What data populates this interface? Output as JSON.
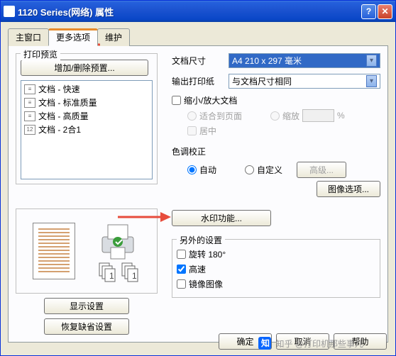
{
  "window": {
    "title": "1120 Series(网络) 属性"
  },
  "titlebar_buttons": {
    "help": "?",
    "close": "✕"
  },
  "tabs": [
    "主窗口",
    "更多选项",
    "维护"
  ],
  "active_tab": 1,
  "preview": {
    "group_label": "打印预览",
    "add_button": "增加/删除预置...",
    "items": [
      {
        "label": "文档 - 快速"
      },
      {
        "label": "文档 - 标准质量"
      },
      {
        "label": "文档 - 高质量"
      },
      {
        "label": "文档 - 2合1"
      }
    ],
    "show_settings": "显示设置",
    "restore_defaults": "恢复缺省设置"
  },
  "right": {
    "paper_size_label": "文档尺寸",
    "paper_size_value": "A4 210 x 297 毫米",
    "output_paper_label": "输出打印纸",
    "output_paper_value": "与文档尺寸相同",
    "zoom_check": "缩小/放大文档",
    "fit_page": "适合到页面",
    "zoom": "缩放",
    "percent": "%",
    "center": "居中",
    "color_label": "色调校正",
    "auto": "自动",
    "custom": "自定义",
    "advanced": "高级...",
    "image_options": "图像选项...",
    "watermark_btn": "水印功能...",
    "extra_label": "另外的设置",
    "rotate": "旋转 180°",
    "highspeed": "高速",
    "mirror": "镜像图像"
  },
  "footer": {
    "ok": "确定",
    "cancel": "取消",
    "help": "帮助"
  },
  "branding": "知乎 @打印机那些事儿"
}
